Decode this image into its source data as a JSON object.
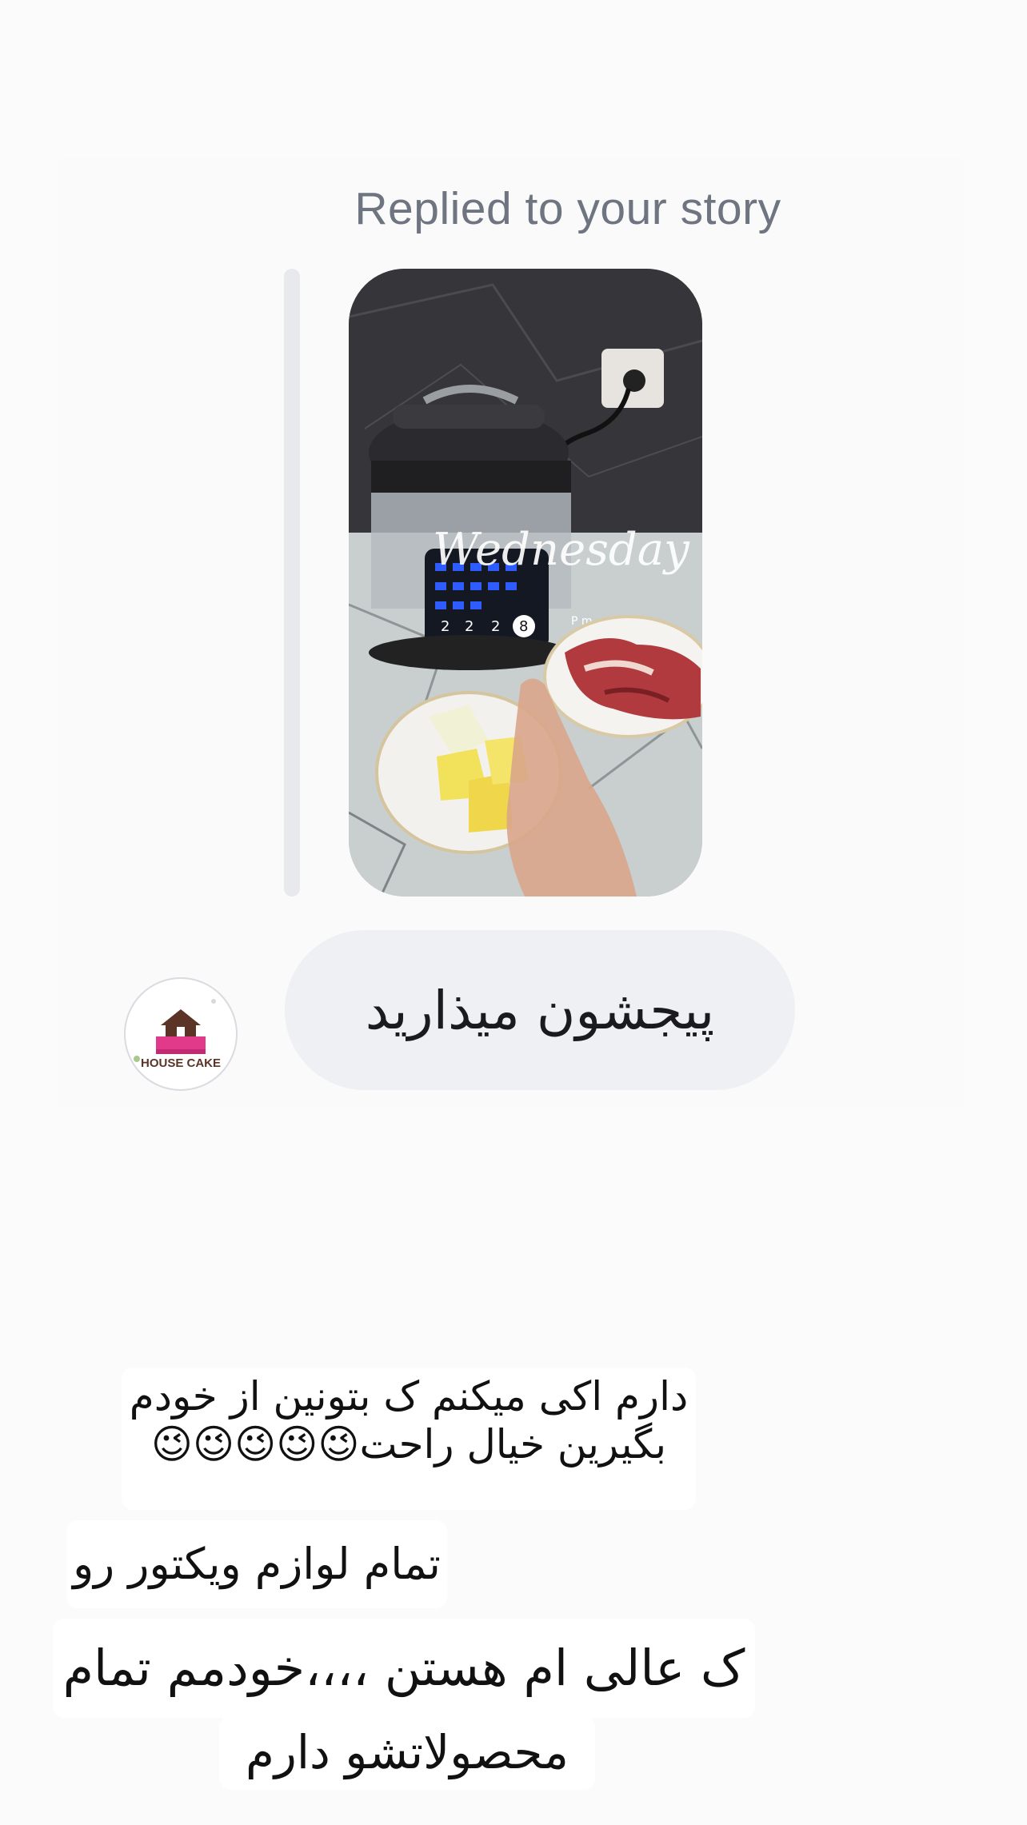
{
  "reply": {
    "label": "Replied to your story"
  },
  "story": {
    "overlay_text": "Wednesday",
    "display_digits": [
      "2",
      "2",
      "2",
      "8"
    ],
    "overlay_small": "P  m"
  },
  "message": {
    "text": "پیجشون میذارید"
  },
  "avatar": {
    "label": "HOUSE CAKE"
  },
  "captions": {
    "line1a": "دارم اکی میکنم ک بتونین از خودم",
    "line1b": "بگیرین خیال راحت😉😉😉😉😉",
    "line2": "تمام لوازم ویکتور رو",
    "line3a": "ک عالی ام هستن ،،،،خودمم تمام",
    "line3b": "محصولاتشو دارم"
  }
}
